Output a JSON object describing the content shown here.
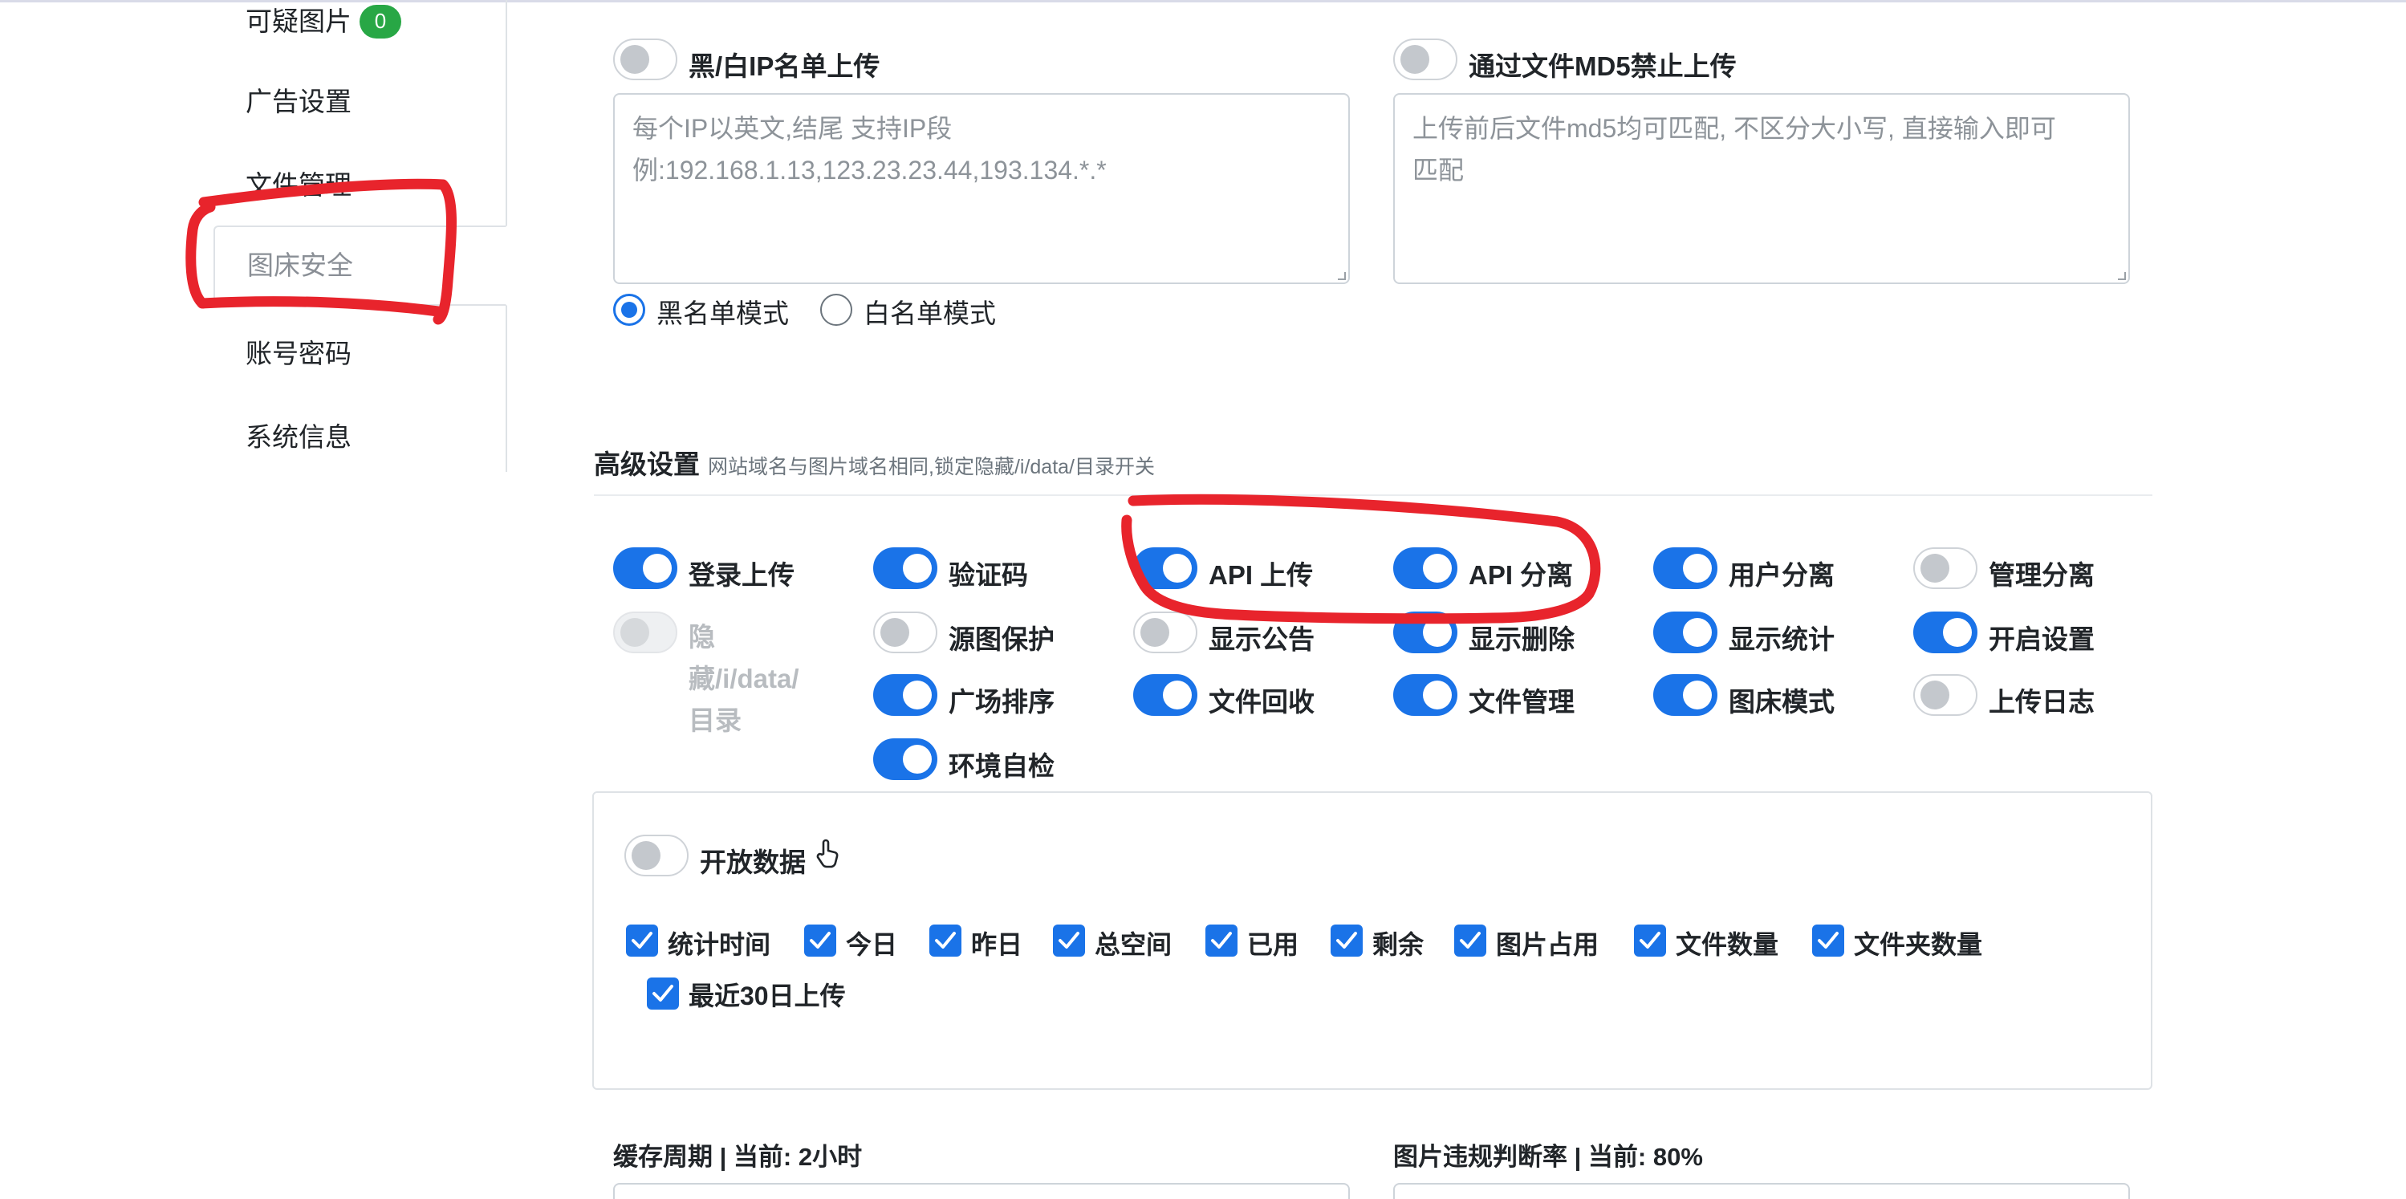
{
  "sidebar": {
    "items": [
      {
        "label": "可疑图片",
        "badge": "0"
      },
      {
        "label": "广告设置"
      },
      {
        "label": "文件管理"
      },
      {
        "label": "图床安全",
        "active": true
      },
      {
        "label": "账号密码"
      },
      {
        "label": "系统信息"
      }
    ]
  },
  "ip_upload": {
    "toggle_label": "黑/白IP名单上传",
    "enabled": false,
    "placeholder_line1": "每个IP以英文,结尾 支持IP段",
    "placeholder_line2": "例:192.168.1.13,123.23.23.44,193.134.*.*",
    "mode_black": "黑名单模式",
    "mode_white": "白名单模式",
    "selected_mode": "黑名单模式"
  },
  "md5_block": {
    "toggle_label": "通过文件MD5禁止上传",
    "enabled": false,
    "placeholder_line1": "上传前后文件md5均可匹配, 不区分大小写, 直接输入即可",
    "placeholder_line2": "匹配"
  },
  "advanced": {
    "title": "高级设置",
    "desc": "网站域名与图片域名相同,锁定隐藏/i/data/目录开关",
    "toggles": [
      {
        "label": "登录上传",
        "on": true
      },
      {
        "label": "验证码",
        "on": true
      },
      {
        "label": "API 上传",
        "on": true
      },
      {
        "label": "API 分离",
        "on": true
      },
      {
        "label": "用户分离",
        "on": true
      },
      {
        "label": "管理分离",
        "on": false
      },
      {
        "label": "隐藏/i/data/目录",
        "on": false,
        "disabled": true
      },
      {
        "label": "源图保护",
        "on": false
      },
      {
        "label": "显示公告",
        "on": false
      },
      {
        "label": "显示删除",
        "on": true
      },
      {
        "label": "显示统计",
        "on": true
      },
      {
        "label": "开启设置",
        "on": true
      },
      {
        "label": "广场排序",
        "on": true
      },
      {
        "label": "文件回收",
        "on": true
      },
      {
        "label": "文件管理",
        "on": true
      },
      {
        "label": "图床模式",
        "on": true
      },
      {
        "label": "上传日志",
        "on": false
      },
      {
        "label": "环境自检",
        "on": true
      }
    ],
    "hidden_dir_lines": [
      "隐",
      "藏/i/data/",
      "目录"
    ]
  },
  "open_data": {
    "toggle_label": "开放数据",
    "enabled": false,
    "icon": "hand-pointer-icon",
    "checkboxes": [
      {
        "label": "统计时间",
        "checked": true
      },
      {
        "label": "今日",
        "checked": true
      },
      {
        "label": "昨日",
        "checked": true
      },
      {
        "label": "总空间",
        "checked": true
      },
      {
        "label": "已用",
        "checked": true
      },
      {
        "label": "剩余",
        "checked": true
      },
      {
        "label": "图片占用",
        "checked": true
      },
      {
        "label": "文件数量",
        "checked": true
      },
      {
        "label": "文件夹数量",
        "checked": true
      },
      {
        "label": "最近30日上传",
        "checked": true
      }
    ]
  },
  "bottom": {
    "cache_label": "缓存周期 | 当前: 2小时",
    "violation_label": "图片违规判断率 | 当前: 80%"
  },
  "colors": {
    "accent": "#1a73e8",
    "badge": "#28a745",
    "annotation": "#e8242c"
  }
}
